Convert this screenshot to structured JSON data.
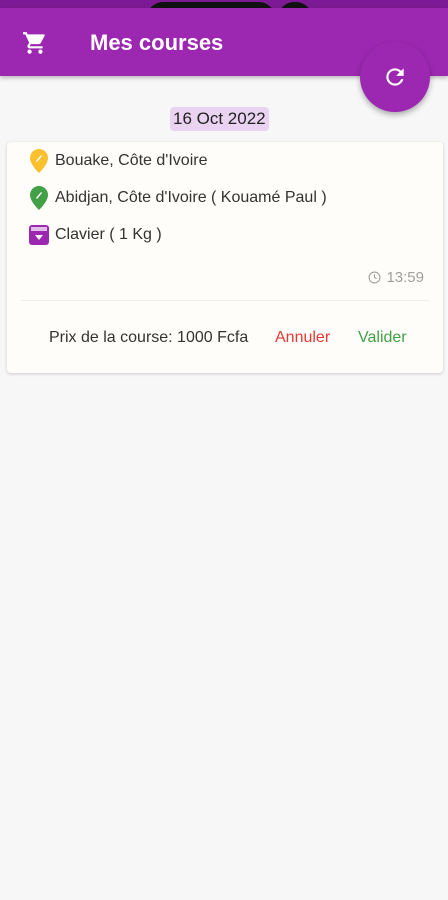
{
  "app": {
    "title": "Mes courses"
  },
  "status_bar": {
    "icons": [
      "whatsapp-icon",
      "bell-icon",
      "settings-icon"
    ]
  },
  "date_chip": "16 Oct 2022",
  "card": {
    "origin": "Bouake, Côte d'Ivoire",
    "destination": "Abidjan, Côte d'Ivoire ( Kouamé Paul )",
    "package": "Clavier ( 1 Kg )",
    "time": "13:59",
    "price": "Prix de la course: 1000 Fcfa",
    "cancel_label": "Annuler",
    "validate_label": "Valider"
  },
  "colors": {
    "primary": "#9c27b0",
    "origin_pin": "#fbc02d",
    "destination_pin": "#43a047",
    "cancel": "#e53935",
    "validate": "#43a047",
    "date_chip_bg": "#ead3f1"
  }
}
